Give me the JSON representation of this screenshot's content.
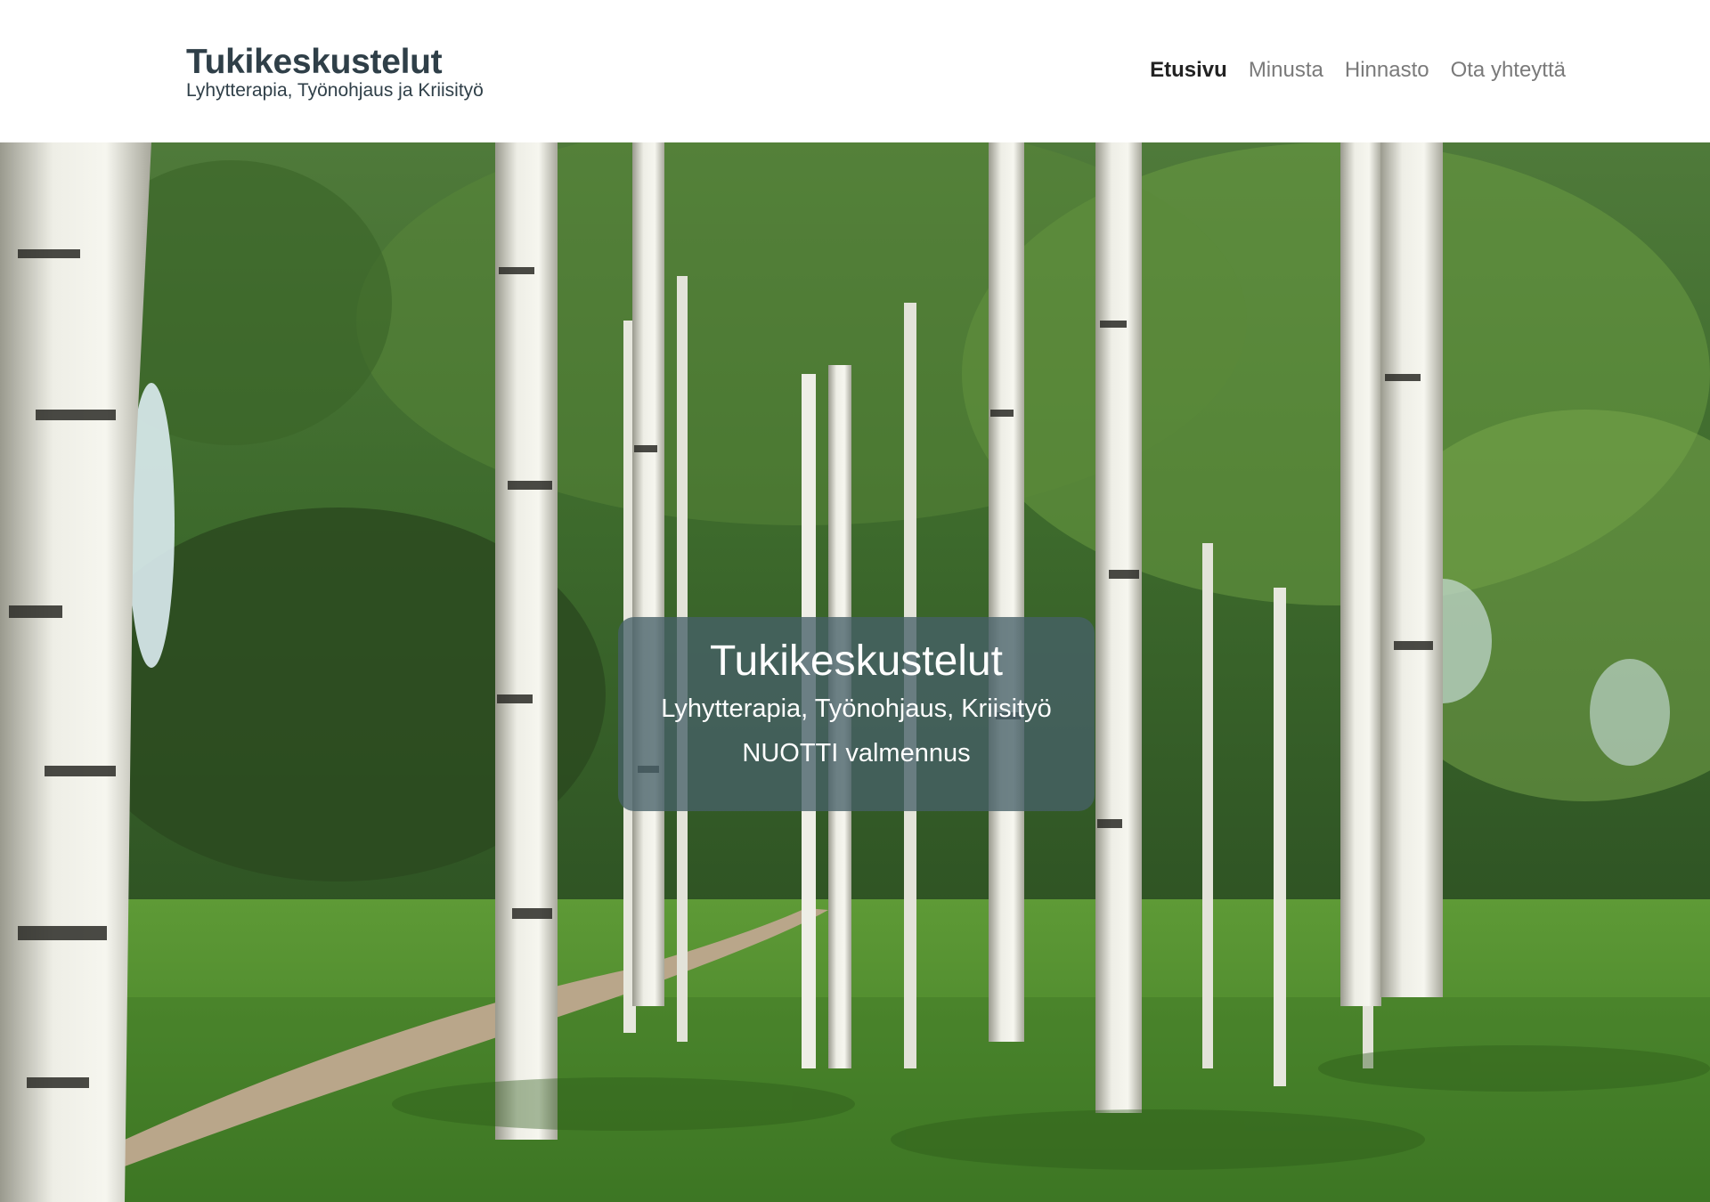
{
  "header": {
    "title": "Tukikeskustelut",
    "tagline": "Lyhytterapia, Työnohjaus ja Kriisityö"
  },
  "nav": {
    "items": [
      {
        "label": "Etusivu",
        "active": true
      },
      {
        "label": "Minusta",
        "active": false
      },
      {
        "label": "Hinnasto",
        "active": false
      },
      {
        "label": "Ota yhteyttä",
        "active": false
      }
    ]
  },
  "hero": {
    "image": "birch-forest-park-photo",
    "title": "Tukikeskustelut",
    "line1": "Lyhytterapia, Työnohjaus, Kriisityö",
    "line2": "NUOTTI valmennus"
  },
  "colors": {
    "brand_text": "#2f3f48",
    "nav_active": "#222222",
    "nav_inactive": "#7a7a7a",
    "hero_box": "#466068"
  }
}
